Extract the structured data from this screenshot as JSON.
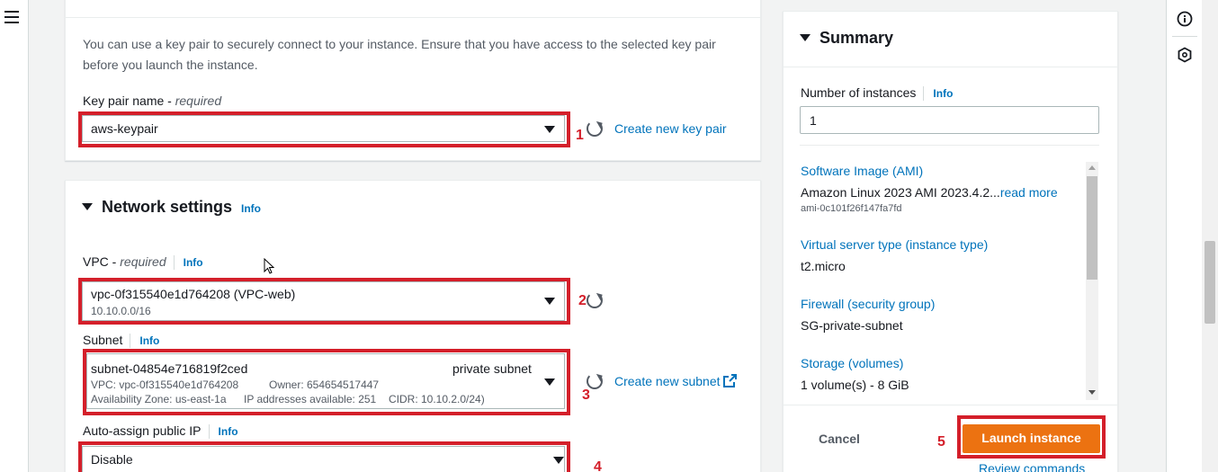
{
  "key_pair": {
    "description": "You can use a key pair to securely connect to your instance. Ensure that you have access to the selected key pair before you launch the instance.",
    "label": "Key pair name",
    "required": "required",
    "selected": "aws-keypair",
    "create_link": "Create new key pair",
    "annotation": "1"
  },
  "network": {
    "title": "Network settings",
    "info": "Info",
    "vpc": {
      "label": "VPC",
      "required": "required",
      "info": "Info",
      "selected": "vpc-0f315540e1d764208 (VPC-web)",
      "cidr": "10.10.0.0/16",
      "annotation": "2"
    },
    "subnet": {
      "label": "Subnet",
      "info": "Info",
      "selected": "subnet-04854e716819f2ced",
      "name": "private subnet",
      "vpc_line": "VPC: vpc-0f315540e1d764208",
      "owner": "Owner: 654654517447",
      "az": "Availability Zone: us-east-1a",
      "ips": "IP addresses available: 251",
      "cidr": "CIDR: 10.10.2.0/24)",
      "create_link": "Create new subnet",
      "annotation": "3"
    },
    "public_ip": {
      "label": "Auto-assign public IP",
      "info": "Info",
      "selected": "Disable",
      "annotation": "4"
    }
  },
  "summary": {
    "title": "Summary",
    "instances_label": "Number of instances",
    "info": "Info",
    "instances_value": "1",
    "ami_key": "Software Image (AMI)",
    "ami_value": "Amazon Linux 2023 AMI 2023.4.2...",
    "ami_read_more": "read more",
    "ami_id": "ami-0c101f26f147fa7fd",
    "type_key": "Virtual server type (instance type)",
    "type_value": "t2.micro",
    "fw_key": "Firewall (security group)",
    "fw_value": "SG-private-subnet",
    "storage_key": "Storage (volumes)",
    "storage_value": "1 volume(s) - 8 GiB",
    "cancel": "Cancel",
    "launch": "Launch instance",
    "review": "Review commands",
    "annotation": "5"
  },
  "colors": {
    "accent": "#0073bb",
    "launch": "#ec7211",
    "annotation_red": "#d41f2a"
  },
  "icons": [
    "menu-icon",
    "refresh-icon",
    "external-link-icon",
    "info-circle-icon",
    "settings-hex-icon",
    "caret-down-icon"
  ]
}
